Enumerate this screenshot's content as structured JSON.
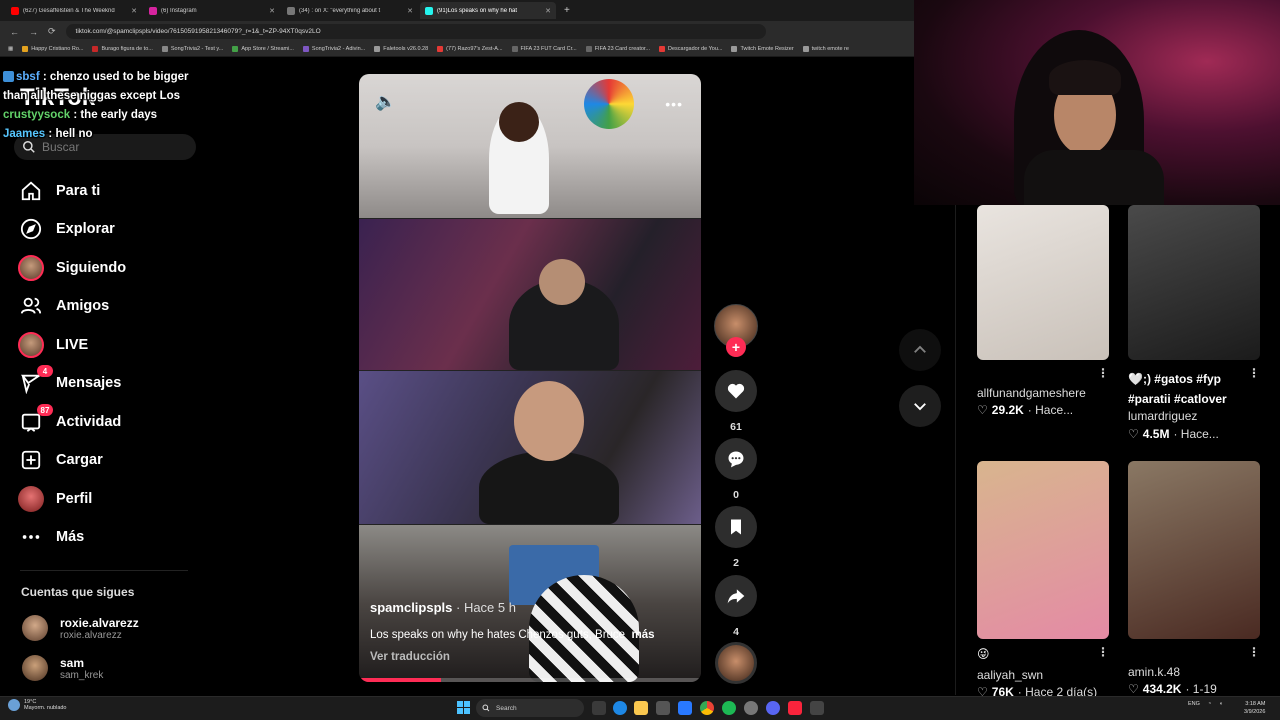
{
  "browser": {
    "tabs": [
      {
        "label": "(627) Gesaffelstein & The Weeknd",
        "color": "#ff0000",
        "active": false
      },
      {
        "label": "(6) Instagram",
        "color": "#d6249f",
        "active": false
      },
      {
        "label": "(34) : on X: \"everything about t",
        "color": "#777777",
        "active": false
      },
      {
        "label": "(91)Los speaks on why he hat",
        "color": "#25f4ee",
        "active": true
      }
    ],
    "new_tab": "+",
    "url": "tiktok.com/@spamclipspls/video/7615059195821346079?_r=1&_t=ZP-94XT0qsv2LO",
    "bookmarks": [
      {
        "label": "Happy Cristiano Ro...",
        "color": "#e4a21f"
      },
      {
        "label": "Burago figura de to...",
        "color": "#c62828"
      },
      {
        "label": "SongTrivia2 - Test y...",
        "color": "#888888"
      },
      {
        "label": "App Store / Streami...",
        "color": "#43a047"
      },
      {
        "label": "SongTrivia2 - Adivin...",
        "color": "#7e57c2"
      },
      {
        "label": "Faletools v26.0.28",
        "color": "#999999"
      },
      {
        "label": "(77) Razo97's Zest-A...",
        "color": "#e53935"
      },
      {
        "label": "FIFA 23 FUT Card Cr...",
        "color": "#666666"
      },
      {
        "label": "FIFA 23 Card creator...",
        "color": "#666666"
      },
      {
        "label": "Descargador de You...",
        "color": "#e53935"
      },
      {
        "label": "Twitch Emote Resizer",
        "color": "#999999"
      },
      {
        "label": "twitch emote re",
        "color": "#999999"
      }
    ]
  },
  "sidebar": {
    "logo": "TikTok",
    "search_placeholder": "Buscar",
    "items": [
      {
        "label": "Para ti",
        "icon": "home-icon"
      },
      {
        "label": "Explorar",
        "icon": "compass-icon"
      },
      {
        "label": "Siguiendo",
        "icon": "avatar"
      },
      {
        "label": "Amigos",
        "icon": "friends-icon"
      },
      {
        "label": "LIVE",
        "icon": "avatar"
      },
      {
        "label": "Mensajes",
        "icon": "messages-icon",
        "badge": "4"
      },
      {
        "label": "Actividad",
        "icon": "activity-icon",
        "badge": "87"
      },
      {
        "label": "Cargar",
        "icon": "upload-icon"
      },
      {
        "label": "Perfil",
        "icon": "avatar"
      },
      {
        "label": "Más",
        "icon": "more-icon"
      }
    ],
    "following_title": "Cuentas que sigues",
    "following": [
      {
        "name": "roxie.alvarezz",
        "handle": "roxie.alvarezz"
      },
      {
        "name": "sam",
        "handle": "sam_krek"
      }
    ]
  },
  "chat": [
    {
      "user": "sbsf",
      "message": ": chenzo used to be bigger than all these niggas except Los"
    },
    {
      "user": "crustyysock",
      "message": ": the early days"
    },
    {
      "user": "Jaames",
      "message": ": hell no"
    }
  ],
  "video": {
    "username": "spamclipspls",
    "posted": "· Hace 5 h",
    "caption": "Los speaks on why he hates Chenzos guts, Bruce",
    "more": "más",
    "translate": "Ver traducción",
    "progress": 0.24,
    "likes": "61",
    "comments": "0",
    "saves": "2",
    "shares": "4"
  },
  "grid": [
    {
      "caption": "",
      "user": "allfunandgameshere",
      "stats": "29.2K",
      "time": "· Hace...",
      "colors": [
        "#e9e4df",
        "#c9c1b9"
      ]
    },
    {
      "caption": "🤍;) #gatos #fyp #paratii #catlover",
      "user": "lumardriguez",
      "stats": "4.5M",
      "time": "· Hace...",
      "colors": [
        "#4a4a4a",
        "#1b1b1b"
      ]
    },
    {
      "caption": "😜",
      "user": "aaliyah_swn",
      "stats": "76K",
      "time": "· Hace 2 día(s)",
      "colors": [
        "#d8b58e",
        "#e48aa5"
      ]
    },
    {
      "caption": "",
      "user": "amin.k.48",
      "stats": "434.2K",
      "time": "· 1-19",
      "colors": [
        "#8a7864",
        "#4a2a22"
      ]
    }
  ],
  "taskbar": {
    "weather_temp": "19°C",
    "weather_desc": "Mayorm. nublado",
    "search": "Search",
    "lang": "ENG",
    "time": "3:18 AM",
    "date": "3/9/2026"
  }
}
